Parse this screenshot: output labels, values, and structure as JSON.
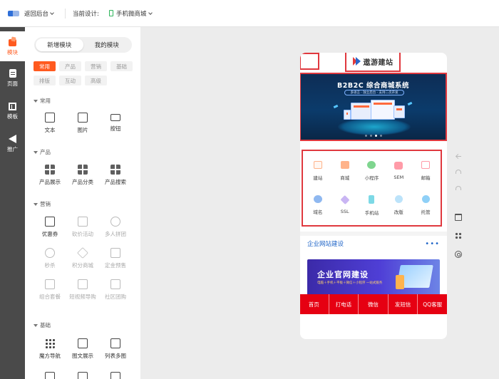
{
  "topbar": {
    "back_label": "返回后台",
    "current_design_label": "当前设计:",
    "site_name": "手机微商城"
  },
  "rail": {
    "items": [
      {
        "label": "模块",
        "icon": "modules-icon",
        "active": true
      },
      {
        "label": "页面",
        "icon": "page-icon"
      },
      {
        "label": "模板",
        "icon": "template-icon"
      },
      {
        "label": "推广",
        "icon": "promotion-icon"
      }
    ]
  },
  "panel": {
    "tabs": [
      {
        "label": "新增模块",
        "active": true
      },
      {
        "label": "我的模块"
      }
    ],
    "filters": [
      "常用",
      "产品",
      "营销",
      "基础",
      "排版",
      "互动",
      "高级"
    ],
    "groups": [
      {
        "title": "常用",
        "items": [
          {
            "label": "文本",
            "icon": "text-icon"
          },
          {
            "label": "图片",
            "icon": "image-icon"
          },
          {
            "label": "按钮",
            "icon": "button-icon"
          }
        ]
      },
      {
        "title": "产品",
        "items": [
          {
            "label": "产品展示",
            "icon": "product-grid-icon"
          },
          {
            "label": "产品分类",
            "icon": "product-category-icon"
          },
          {
            "label": "产品搜索",
            "icon": "product-search-icon"
          }
        ]
      },
      {
        "title": "营销",
        "items": [
          {
            "label": "优惠券",
            "icon": "coupon-icon",
            "enabled": true
          },
          {
            "label": "砍价活动",
            "icon": "bargain-icon"
          },
          {
            "label": "多人拼团",
            "icon": "group-buy-icon"
          },
          {
            "label": "秒杀",
            "icon": "flash-sale-icon"
          },
          {
            "label": "积分商城",
            "icon": "points-mall-icon"
          },
          {
            "label": "定金预售",
            "icon": "presale-icon"
          },
          {
            "label": "组合套餐",
            "icon": "bundle-icon"
          },
          {
            "label": "短视频导购",
            "icon": "short-video-icon"
          },
          {
            "label": "社区团购",
            "icon": "community-buy-icon"
          }
        ]
      },
      {
        "title": "基础",
        "items": [
          {
            "label": "魔方导航",
            "icon": "cube-nav-icon"
          },
          {
            "label": "图文展示",
            "icon": "image-text-icon"
          },
          {
            "label": "列表多图",
            "icon": "list-multi-image-icon"
          }
        ]
      }
    ]
  },
  "phone": {
    "brand": "遨游建站",
    "banner": {
      "title": "B2B2C 综合商城系统",
      "subtitle": "多语言 · 独立后台 · 支持二次开发"
    },
    "services": [
      {
        "label": "建站",
        "icon": "monitor-icon"
      },
      {
        "label": "商城",
        "icon": "cart-icon"
      },
      {
        "label": "小程序",
        "icon": "miniprogram-icon"
      },
      {
        "label": "SEM",
        "icon": "money-bag-icon"
      },
      {
        "label": "邮箱",
        "icon": "mail-icon"
      },
      {
        "label": "域名",
        "icon": "globe-icon"
      },
      {
        "label": "SSL",
        "icon": "shield-lock-icon"
      },
      {
        "label": "手机站",
        "icon": "mobile-icon"
      },
      {
        "label": "改版",
        "icon": "magnifier-icon"
      },
      {
        "label": "托管",
        "icon": "wrench-icon"
      }
    ],
    "section": {
      "title": "企业网站建设",
      "more": "•••"
    },
    "promo": {
      "title": "企业官网建设",
      "subtitle": "电脑＋手机＋平板＋微信＋小程序 一站式服务"
    },
    "bottom_nav": [
      "首页",
      "打电话",
      "微信",
      "发短信",
      "QQ客服"
    ]
  },
  "colors": {
    "accent": "#ff5a1f",
    "selection": "#e0383e",
    "bottom_nav": "#e60012",
    "section_link": "#2166c8"
  }
}
